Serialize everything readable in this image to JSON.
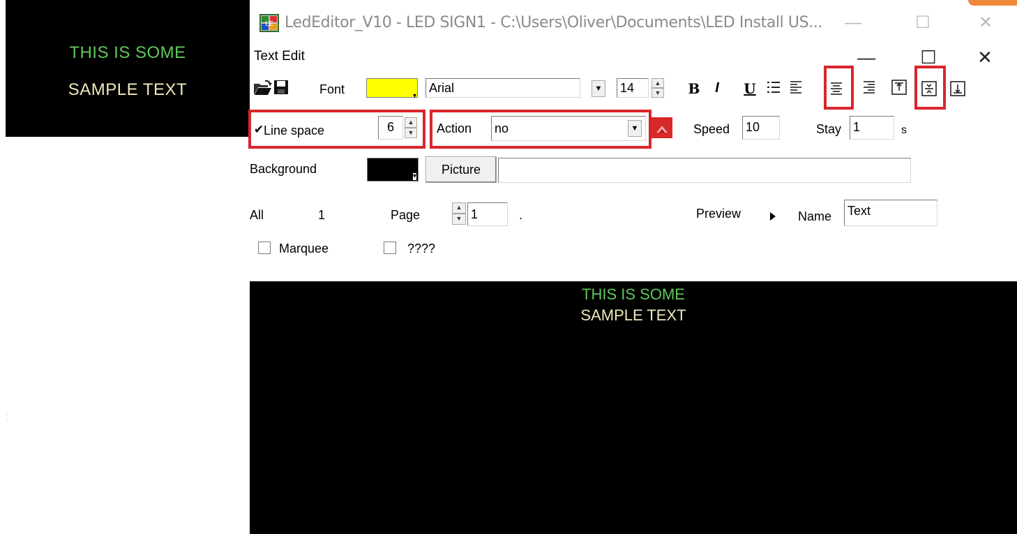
{
  "sign_preview": {
    "line1": "THIS IS SOME",
    "line2": "SAMPLE TEXT",
    "line1_color": "#5fc85a",
    "line2_color": "#efe8b8",
    "stray_char": ":"
  },
  "parent_window": {
    "title": "LedEditor_V10 - LED SIGN1 - C:\\Users\\Oliver\\Documents\\LED Install US...",
    "min_glyph": "—",
    "max_glyph": "☐",
    "close_glyph": "✕",
    "app_icon_text": "LE"
  },
  "dialog": {
    "title": "Text Edit",
    "min_glyph": "—",
    "max_glyph": "☐",
    "close_glyph": "✕",
    "toolbar": {
      "font_label": "Font",
      "font_color": "#ffff00",
      "font_name": "Arial",
      "font_size": "14",
      "bold": "B",
      "italic": "I",
      "underline": "U"
    },
    "line_space": {
      "checked": true,
      "label": "Line space",
      "value": "6"
    },
    "action": {
      "label": "Action",
      "value": "no"
    },
    "speed": {
      "label": "Speed",
      "value": "10"
    },
    "stay": {
      "label": "Stay",
      "value": "1",
      "unit": "s"
    },
    "background": {
      "label": "Background",
      "color": "#000000",
      "picture_button": "Picture",
      "picture_path": ""
    },
    "pages": {
      "all_label": "All",
      "all_value": "1",
      "page_label": "Page",
      "page_value": "1",
      "dot": "."
    },
    "preview_label": "Preview",
    "name": {
      "label": "Name",
      "value": "Text"
    },
    "marquee": {
      "label": "Marquee",
      "checked": false
    },
    "unknown": {
      "label": "????",
      "checked": false
    }
  },
  "preview": {
    "line1": "THIS IS SOME",
    "line2": "SAMPLE TEXT",
    "line1_color": "#5fc85a",
    "line2_color": "#efe8b8"
  },
  "colors": {
    "highlight": "#d9262c",
    "accent_orange": "#f0883a"
  }
}
